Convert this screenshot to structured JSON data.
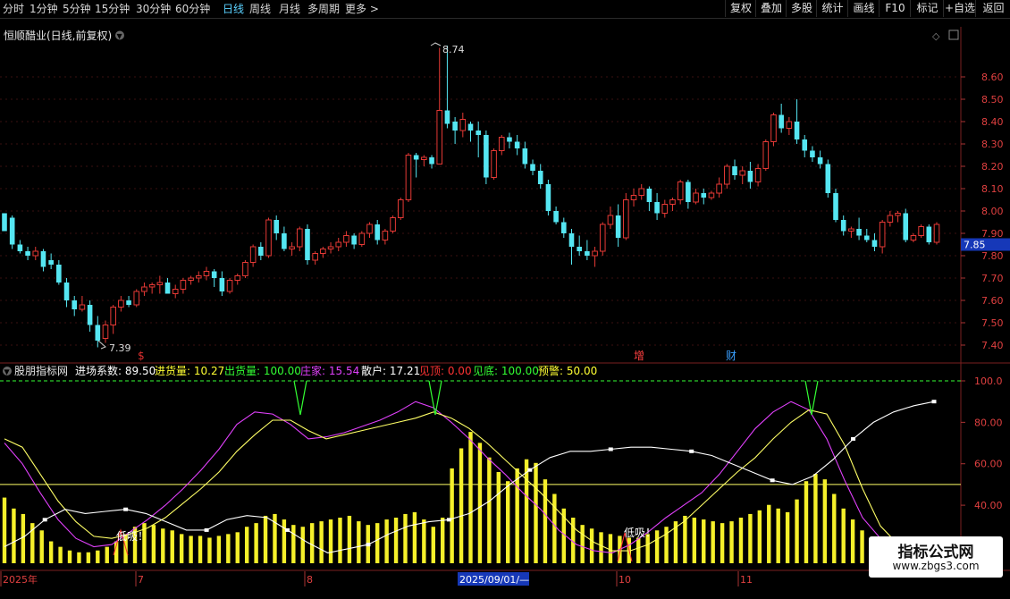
{
  "toolbar": {
    "timeframes": [
      "分时",
      "1分钟",
      "5分钟",
      "15分钟",
      "30分钟",
      "60分钟",
      "日线",
      "周线",
      "月线",
      "多周期",
      "更多 >"
    ],
    "active_timeframe": "日线",
    "buttons": [
      "复权",
      "叠加",
      "多股",
      "统计",
      "画线",
      "F10",
      "标记",
      "+自选",
      "返回"
    ]
  },
  "main_chart": {
    "title": "恒顺醋业(日线,前复权)",
    "high_label": "8.74",
    "low_label": "7.39",
    "current_price": "7.85",
    "y_ticks": [
      "8.60",
      "8.50",
      "8.40",
      "8.30",
      "8.20",
      "8.10",
      "8.00",
      "7.90",
      "7.80",
      "7.70",
      "7.60",
      "7.50",
      "7.40"
    ],
    "markers": [
      {
        "text": "$",
        "color": "#e03030"
      },
      {
        "text": "增",
        "color": "#ff4040"
      },
      {
        "text": "财",
        "color": "#3aa0ff"
      }
    ],
    "up_color": "#e53935",
    "down_color": "#55e6f2"
  },
  "indicator": {
    "name": "股朋指标网",
    "items": [
      {
        "label": "进场系数: 89.50",
        "color": "#ffffff"
      },
      {
        "label": "进货量: 10.27",
        "color": "#ffff33"
      },
      {
        "label": "出货量: 100.00",
        "color": "#33ff33"
      },
      {
        "label": "庄家: 15.54",
        "color": "#e040fb"
      },
      {
        "label": "散户: 17.21",
        "color": "#ffffff"
      },
      {
        "label": "见顶: 0.00",
        "color": "#ff3333"
      },
      {
        "label": "见底: 100.00",
        "color": "#33ff33"
      },
      {
        "label": "预警: 50.00",
        "color": "#ffff33"
      }
    ],
    "y_ticks": [
      "100.0",
      "80.00",
      "60.00",
      "40.00",
      "20.00"
    ],
    "annotations": [
      "低吸！",
      "低吸！"
    ]
  },
  "x_axis": {
    "labels": [
      "2025年",
      "7",
      "8",
      "10",
      "11"
    ],
    "cursor_label": "2025/09/01/—"
  },
  "watermark": {
    "line1": "指标公式网",
    "line2": "www.zbgs3.com"
  },
  "chart_data": {
    "type": "candlestick",
    "ohlc": [
      [
        7.99,
        7.99,
        7.91,
        7.91
      ],
      [
        7.97,
        7.98,
        7.83,
        7.85
      ],
      [
        7.85,
        7.87,
        7.81,
        7.82
      ],
      [
        7.82,
        7.84,
        7.78,
        7.8
      ],
      [
        7.8,
        7.84,
        7.78,
        7.82
      ],
      [
        7.82,
        7.83,
        7.73,
        7.75
      ],
      [
        7.78,
        7.81,
        7.74,
        7.76
      ],
      [
        7.76,
        7.78,
        7.67,
        7.68
      ],
      [
        7.68,
        7.7,
        7.57,
        7.6
      ],
      [
        7.6,
        7.62,
        7.53,
        7.56
      ],
      [
        7.56,
        7.62,
        7.55,
        7.58
      ],
      [
        7.58,
        7.6,
        7.46,
        7.49
      ],
      [
        7.49,
        7.53,
        7.39,
        7.42
      ],
      [
        7.43,
        7.51,
        7.41,
        7.49
      ],
      [
        7.49,
        7.58,
        7.45,
        7.57
      ],
      [
        7.57,
        7.62,
        7.55,
        7.6
      ],
      [
        7.6,
        7.62,
        7.57,
        7.58
      ],
      [
        7.58,
        7.65,
        7.57,
        7.64
      ],
      [
        7.64,
        7.68,
        7.62,
        7.66
      ],
      [
        7.66,
        7.68,
        7.63,
        7.67
      ],
      [
        7.67,
        7.71,
        7.63,
        7.68
      ],
      [
        7.68,
        7.7,
        7.63,
        7.63
      ],
      [
        7.63,
        7.67,
        7.61,
        7.65
      ],
      [
        7.65,
        7.7,
        7.63,
        7.69
      ],
      [
        7.69,
        7.71,
        7.67,
        7.7
      ],
      [
        7.7,
        7.73,
        7.68,
        7.71
      ],
      [
        7.71,
        7.75,
        7.69,
        7.73
      ],
      [
        7.73,
        7.74,
        7.66,
        7.7
      ],
      [
        7.7,
        7.73,
        7.62,
        7.64
      ],
      [
        7.64,
        7.7,
        7.63,
        7.69
      ],
      [
        7.69,
        7.72,
        7.67,
        7.71
      ],
      [
        7.71,
        7.78,
        7.7,
        7.77
      ],
      [
        7.77,
        7.85,
        7.75,
        7.84
      ],
      [
        7.84,
        7.86,
        7.78,
        7.8
      ],
      [
        7.8,
        7.97,
        7.79,
        7.96
      ],
      [
        7.96,
        7.98,
        7.87,
        7.9
      ],
      [
        7.9,
        7.93,
        7.82,
        7.83
      ],
      [
        7.83,
        7.86,
        7.8,
        7.84
      ],
      [
        7.84,
        7.93,
        7.82,
        7.92
      ],
      [
        7.92,
        7.94,
        7.76,
        7.78
      ],
      [
        7.78,
        7.82,
        7.76,
        7.81
      ],
      [
        7.81,
        7.84,
        7.79,
        7.83
      ],
      [
        7.83,
        7.86,
        7.81,
        7.84
      ],
      [
        7.84,
        7.88,
        7.82,
        7.86
      ],
      [
        7.86,
        7.91,
        7.84,
        7.89
      ],
      [
        7.89,
        7.9,
        7.83,
        7.85
      ],
      [
        7.85,
        7.91,
        7.84,
        7.9
      ],
      [
        7.9,
        7.95,
        7.88,
        7.94
      ],
      [
        7.94,
        7.96,
        7.85,
        7.87
      ],
      [
        7.87,
        7.92,
        7.85,
        7.91
      ],
      [
        7.91,
        7.98,
        7.9,
        7.97
      ],
      [
        7.97,
        8.06,
        7.96,
        8.05
      ],
      [
        8.05,
        8.26,
        8.04,
        8.25
      ],
      [
        8.25,
        8.26,
        8.15,
        8.23
      ],
      [
        8.23,
        8.25,
        8.2,
        8.24
      ],
      [
        8.24,
        8.25,
        8.19,
        8.21
      ],
      [
        8.21,
        8.73,
        8.21,
        8.45
      ],
      [
        8.45,
        8.74,
        8.37,
        8.39
      ],
      [
        8.4,
        8.42,
        8.3,
        8.36
      ],
      [
        8.36,
        8.44,
        8.33,
        8.41
      ],
      [
        8.39,
        8.4,
        8.31,
        8.36
      ],
      [
        8.36,
        8.4,
        8.24,
        8.34
      ],
      [
        8.34,
        8.36,
        8.12,
        8.15
      ],
      [
        8.15,
        8.28,
        8.14,
        8.27
      ],
      [
        8.27,
        8.34,
        8.25,
        8.33
      ],
      [
        8.33,
        8.35,
        8.28,
        8.31
      ],
      [
        8.31,
        8.34,
        8.25,
        8.28
      ],
      [
        8.28,
        8.31,
        8.19,
        8.21
      ],
      [
        8.21,
        8.23,
        8.16,
        8.18
      ],
      [
        8.18,
        8.21,
        8.1,
        8.12
      ],
      [
        8.12,
        8.14,
        7.98,
        8.0
      ],
      [
        8.0,
        8.02,
        7.94,
        7.95
      ],
      [
        7.95,
        7.97,
        7.88,
        7.9
      ],
      [
        7.9,
        7.92,
        7.76,
        7.84
      ],
      [
        7.84,
        7.89,
        7.8,
        7.82
      ],
      [
        7.82,
        7.87,
        7.78,
        7.8
      ],
      [
        7.8,
        7.84,
        7.75,
        7.82
      ],
      [
        7.82,
        7.95,
        7.8,
        7.94
      ],
      [
        7.94,
        8.02,
        7.92,
        7.98
      ],
      [
        7.98,
        8.03,
        7.84,
        7.88
      ],
      [
        7.88,
        8.08,
        7.87,
        8.05
      ],
      [
        8.05,
        8.1,
        8.02,
        8.07
      ],
      [
        8.07,
        8.12,
        8.05,
        8.1
      ],
      [
        8.1,
        8.11,
        8.0,
        8.04
      ],
      [
        8.04,
        8.08,
        7.96,
        7.99
      ],
      [
        7.99,
        8.05,
        7.97,
        8.03
      ],
      [
        8.03,
        8.06,
        8.0,
        8.05
      ],
      [
        8.05,
        8.14,
        8.03,
        8.13
      ],
      [
        8.13,
        8.14,
        8.01,
        8.04
      ],
      [
        8.04,
        8.1,
        8.03,
        8.08
      ],
      [
        8.08,
        8.1,
        8.03,
        8.06
      ],
      [
        8.06,
        8.09,
        8.05,
        8.08
      ],
      [
        8.08,
        8.15,
        8.06,
        8.12
      ],
      [
        8.12,
        8.21,
        8.1,
        8.2
      ],
      [
        8.2,
        8.23,
        8.14,
        8.16
      ],
      [
        8.16,
        8.2,
        8.12,
        8.18
      ],
      [
        8.18,
        8.22,
        8.1,
        8.13
      ],
      [
        8.13,
        8.21,
        8.11,
        8.19
      ],
      [
        8.19,
        8.32,
        8.18,
        8.31
      ],
      [
        8.31,
        8.44,
        8.29,
        8.43
      ],
      [
        8.43,
        8.48,
        8.35,
        8.37
      ],
      [
        8.37,
        8.42,
        8.34,
        8.4
      ],
      [
        8.4,
        8.5,
        8.3,
        8.32
      ],
      [
        8.32,
        8.34,
        8.24,
        8.27
      ],
      [
        8.27,
        8.29,
        8.22,
        8.24
      ],
      [
        8.24,
        8.27,
        8.19,
        8.21
      ],
      [
        8.21,
        8.23,
        8.06,
        8.08
      ],
      [
        8.08,
        8.1,
        7.95,
        7.96
      ],
      [
        7.96,
        7.98,
        7.89,
        7.91
      ],
      [
        7.91,
        7.93,
        7.88,
        7.92
      ],
      [
        7.92,
        7.97,
        7.87,
        7.89
      ],
      [
        7.89,
        7.92,
        7.86,
        7.87
      ],
      [
        7.87,
        7.9,
        7.82,
        7.84
      ],
      [
        7.84,
        7.96,
        7.81,
        7.95
      ],
      [
        7.95,
        8.0,
        7.93,
        7.98
      ],
      [
        7.98,
        8.0,
        7.95,
        7.99
      ],
      [
        7.99,
        8.01,
        7.86,
        7.87
      ],
      [
        7.87,
        7.9,
        7.86,
        7.89
      ],
      [
        7.89,
        7.94,
        7.88,
        7.93
      ],
      [
        7.93,
        7.94,
        7.85,
        7.86
      ],
      [
        7.86,
        7.95,
        7.85,
        7.94
      ]
    ],
    "indicator_lines": [
      {
        "name": "庄家",
        "color": "#e040fb",
        "values": [
          70,
          60,
          46,
          33,
          24,
          20,
          21,
          27,
          33,
          40,
          48,
          57,
          67,
          79,
          85,
          84,
          79,
          72,
          73,
          75,
          78,
          81,
          85,
          90,
          87,
          80,
          72,
          63,
          55,
          46,
          38,
          28,
          21,
          18,
          17,
          21,
          27,
          34,
          40,
          46,
          55,
          66,
          77,
          85,
          90,
          86,
          72,
          52,
          34,
          24,
          20,
          18,
          16
        ]
      },
      {
        "name": "散户",
        "color": "#ffff66",
        "values": [
          72,
          68,
          55,
          42,
          32,
          25,
          24,
          26,
          29,
          34,
          41,
          48,
          56,
          66,
          74,
          81,
          81,
          76,
          72,
          74,
          76,
          78,
          80,
          82,
          85,
          82,
          77,
          70,
          62,
          54,
          46,
          37,
          28,
          22,
          18,
          18,
          21,
          26,
          32,
          40,
          48,
          56,
          63,
          72,
          80,
          86,
          84,
          69,
          48,
          30,
          21,
          19,
          17
        ]
      },
      {
        "name": "进场系数",
        "color": "#ffffff",
        "values": [
          20,
          25,
          33,
          38,
          36,
          37,
          38,
          36,
          32,
          28,
          28,
          33,
          35,
          34,
          28,
          22,
          17,
          19,
          21,
          26,
          30,
          32,
          33,
          36,
          42,
          50,
          57,
          63,
          66,
          66,
          67,
          68,
          68,
          67,
          66,
          64,
          60,
          56,
          52,
          50,
          54,
          62,
          72,
          80,
          85,
          88,
          90
        ]
      }
    ],
    "volume_bars": [
      36,
      30,
      27,
      22,
      18,
      12,
      9,
      7,
      6,
      6,
      7,
      9,
      12,
      16,
      20,
      22,
      21,
      19,
      18,
      16,
      15,
      15,
      14,
      15,
      16,
      17,
      20,
      22,
      26,
      27,
      24,
      21,
      20,
      22,
      23,
      24,
      25,
      26,
      23,
      21,
      22,
      24,
      25,
      27,
      28,
      24,
      20,
      25,
      52,
      63,
      72,
      66,
      58,
      50,
      45,
      52,
      57,
      55,
      46,
      38,
      30,
      25,
      21,
      19,
      17,
      16,
      15,
      14,
      14,
      16,
      18,
      20,
      23,
      26,
      25,
      24,
      23,
      22,
      23,
      25,
      27,
      29,
      32,
      30,
      28,
      35,
      45,
      49,
      46,
      38,
      30,
      24,
      18,
      14,
      12,
      11,
      12,
      13,
      14,
      13,
      12
    ]
  }
}
